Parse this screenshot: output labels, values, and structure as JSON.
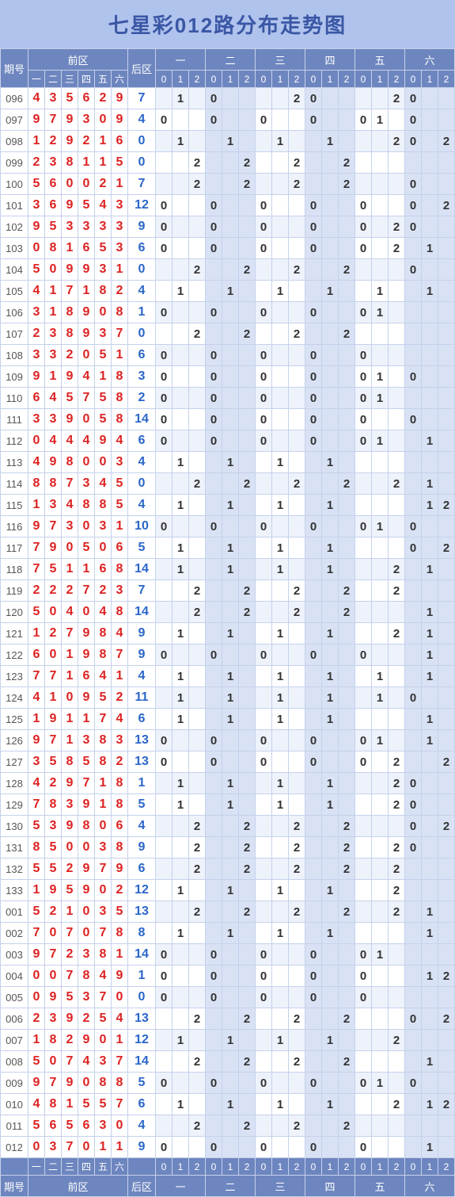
{
  "title": "七星彩012路分布走势图",
  "headers": {
    "issue": "期号",
    "front_group": "前区",
    "front_sub": [
      "一",
      "二",
      "三",
      "四",
      "五",
      "六"
    ],
    "back": "后区",
    "mod_groups": [
      "一",
      "二",
      "三",
      "四",
      "五",
      "六"
    ],
    "mod_sub": [
      "0",
      "1",
      "2"
    ]
  },
  "chart_data": {
    "type": "table",
    "title": "七星彩012路分布走势图",
    "columns": [
      "期号",
      "前区1",
      "前区2",
      "前区3",
      "前区4",
      "前区5",
      "前区6",
      "后区",
      "一0",
      "一1",
      "一2",
      "二0",
      "二1",
      "二2",
      "三0",
      "三1",
      "三2",
      "四0",
      "四1",
      "四2",
      "五0",
      "五1",
      "五2",
      "六0",
      "六1",
      "六2"
    ],
    "rows": [
      [
        "096",
        4,
        3,
        5,
        6,
        2,
        9,
        7,
        null,
        1,
        null,
        0,
        null,
        null,
        null,
        null,
        2,
        0,
        null,
        null,
        null,
        null,
        2,
        0,
        null,
        null
      ],
      [
        "097",
        9,
        7,
        9,
        3,
        0,
        9,
        4,
        0,
        null,
        null,
        0,
        null,
        null,
        0,
        null,
        null,
        0,
        null,
        null,
        0,
        1,
        null,
        0,
        null,
        null
      ],
      [
        "098",
        1,
        2,
        9,
        2,
        1,
        6,
        0,
        null,
        1,
        null,
        null,
        1,
        null,
        null,
        1,
        null,
        null,
        1,
        null,
        null,
        null,
        2,
        0,
        null,
        2
      ],
      [
        "099",
        2,
        3,
        8,
        1,
        1,
        5,
        0,
        null,
        null,
        2,
        null,
        null,
        2,
        null,
        null,
        2,
        null,
        null,
        2,
        null,
        null,
        null,
        null,
        null,
        null
      ],
      [
        "100",
        5,
        6,
        0,
        0,
        2,
        1,
        7,
        null,
        null,
        2,
        null,
        null,
        2,
        null,
        null,
        2,
        null,
        null,
        2,
        null,
        null,
        null,
        0,
        null,
        null
      ],
      [
        "101",
        3,
        6,
        9,
        5,
        4,
        3,
        12,
        0,
        null,
        null,
        0,
        null,
        null,
        0,
        null,
        null,
        0,
        null,
        null,
        0,
        null,
        null,
        0,
        null,
        2
      ],
      [
        "102",
        9,
        5,
        3,
        3,
        3,
        3,
        9,
        0,
        null,
        null,
        0,
        null,
        null,
        0,
        null,
        null,
        0,
        null,
        null,
        0,
        null,
        2,
        0,
        null,
        null
      ],
      [
        "103",
        0,
        8,
        1,
        6,
        5,
        3,
        6,
        0,
        null,
        null,
        0,
        null,
        null,
        0,
        null,
        null,
        0,
        null,
        null,
        0,
        null,
        2,
        null,
        1,
        null
      ],
      [
        "104",
        5,
        0,
        9,
        9,
        3,
        1,
        0,
        null,
        null,
        2,
        null,
        null,
        2,
        null,
        null,
        2,
        null,
        null,
        2,
        null,
        null,
        null,
        0,
        null,
        null
      ],
      [
        "105",
        4,
        1,
        7,
        1,
        8,
        2,
        4,
        null,
        1,
        null,
        null,
        1,
        null,
        null,
        1,
        null,
        null,
        1,
        null,
        null,
        1,
        null,
        null,
        1,
        null
      ],
      [
        "106",
        3,
        1,
        8,
        9,
        0,
        8,
        1,
        0,
        null,
        null,
        0,
        null,
        null,
        0,
        null,
        null,
        0,
        null,
        null,
        0,
        1,
        null,
        null,
        null,
        null
      ],
      [
        "107",
        2,
        3,
        8,
        9,
        3,
        7,
        0,
        null,
        null,
        2,
        null,
        null,
        2,
        null,
        null,
        2,
        null,
        null,
        2,
        null,
        null,
        null,
        null,
        null,
        null
      ],
      [
        "108",
        3,
        3,
        2,
        0,
        5,
        1,
        6,
        0,
        null,
        null,
        0,
        null,
        null,
        0,
        null,
        null,
        0,
        null,
        null,
        0,
        null,
        null,
        null,
        null,
        null
      ],
      [
        "109",
        9,
        1,
        9,
        4,
        1,
        8,
        3,
        0,
        null,
        null,
        0,
        null,
        null,
        0,
        null,
        null,
        0,
        null,
        null,
        0,
        1,
        null,
        0,
        null,
        null
      ],
      [
        "110",
        6,
        4,
        5,
        7,
        5,
        8,
        2,
        0,
        null,
        null,
        0,
        null,
        null,
        0,
        null,
        null,
        0,
        null,
        null,
        0,
        1,
        null,
        null,
        null,
        null
      ],
      [
        "111",
        3,
        3,
        9,
        0,
        5,
        8,
        14,
        0,
        null,
        null,
        0,
        null,
        null,
        0,
        null,
        null,
        0,
        null,
        null,
        0,
        null,
        null,
        0,
        null,
        null
      ],
      [
        "112",
        0,
        4,
        4,
        4,
        9,
        4,
        6,
        0,
        null,
        null,
        0,
        null,
        null,
        0,
        null,
        null,
        0,
        null,
        null,
        0,
        1,
        null,
        null,
        1,
        null
      ],
      [
        "113",
        4,
        9,
        8,
        0,
        0,
        3,
        4,
        null,
        1,
        null,
        null,
        1,
        null,
        null,
        1,
        null,
        null,
        1,
        null,
        null,
        null,
        null,
        null,
        null,
        null
      ],
      [
        "114",
        8,
        8,
        7,
        3,
        4,
        5,
        0,
        null,
        null,
        2,
        null,
        null,
        2,
        null,
        null,
        2,
        null,
        null,
        2,
        null,
        null,
        2,
        null,
        1,
        null
      ],
      [
        "115",
        1,
        3,
        4,
        8,
        8,
        5,
        4,
        null,
        1,
        null,
        null,
        1,
        null,
        null,
        1,
        null,
        null,
        1,
        null,
        null,
        null,
        null,
        null,
        1,
        2
      ],
      [
        "116",
        9,
        7,
        3,
        0,
        3,
        1,
        10,
        0,
        null,
        null,
        0,
        null,
        null,
        0,
        null,
        null,
        0,
        null,
        null,
        0,
        1,
        null,
        0,
        null,
        null
      ],
      [
        "117",
        7,
        9,
        0,
        5,
        0,
        6,
        5,
        null,
        1,
        null,
        null,
        1,
        null,
        null,
        1,
        null,
        null,
        1,
        null,
        null,
        null,
        null,
        0,
        null,
        2
      ],
      [
        "118",
        7,
        5,
        1,
        1,
        6,
        8,
        14,
        null,
        1,
        null,
        null,
        1,
        null,
        null,
        1,
        null,
        null,
        1,
        null,
        null,
        null,
        2,
        null,
        1,
        null
      ],
      [
        "119",
        2,
        2,
        2,
        7,
        2,
        3,
        7,
        null,
        null,
        2,
        null,
        null,
        2,
        null,
        null,
        2,
        null,
        null,
        2,
        null,
        null,
        2,
        null,
        null,
        null
      ],
      [
        "120",
        5,
        0,
        4,
        0,
        4,
        8,
        14,
        null,
        null,
        2,
        null,
        null,
        2,
        null,
        null,
        2,
        null,
        null,
        2,
        null,
        null,
        null,
        null,
        1,
        null
      ],
      [
        "121",
        1,
        2,
        7,
        9,
        8,
        4,
        9,
        null,
        1,
        null,
        null,
        1,
        null,
        null,
        1,
        null,
        null,
        1,
        null,
        null,
        null,
        2,
        null,
        1,
        null
      ],
      [
        "122",
        6,
        0,
        1,
        9,
        8,
        7,
        9,
        0,
        null,
        null,
        0,
        null,
        null,
        0,
        null,
        null,
        0,
        null,
        null,
        0,
        null,
        null,
        null,
        1,
        null
      ],
      [
        "123",
        7,
        7,
        1,
        6,
        4,
        1,
        4,
        null,
        1,
        null,
        null,
        1,
        null,
        null,
        1,
        null,
        null,
        1,
        null,
        null,
        1,
        null,
        null,
        1,
        null
      ],
      [
        "124",
        4,
        1,
        0,
        9,
        5,
        2,
        11,
        null,
        1,
        null,
        null,
        1,
        null,
        null,
        1,
        null,
        null,
        1,
        null,
        null,
        1,
        null,
        0,
        null,
        null
      ],
      [
        "125",
        1,
        9,
        1,
        1,
        7,
        4,
        6,
        null,
        1,
        null,
        null,
        1,
        null,
        null,
        1,
        null,
        null,
        1,
        null,
        null,
        null,
        null,
        null,
        1,
        null
      ],
      [
        "126",
        9,
        7,
        1,
        3,
        8,
        3,
        13,
        0,
        null,
        null,
        0,
        null,
        null,
        0,
        null,
        null,
        0,
        null,
        null,
        0,
        1,
        null,
        null,
        1,
        null
      ],
      [
        "127",
        3,
        5,
        8,
        5,
        8,
        2,
        13,
        0,
        null,
        null,
        0,
        null,
        null,
        0,
        null,
        null,
        0,
        null,
        null,
        0,
        null,
        2,
        null,
        null,
        2
      ],
      [
        "128",
        4,
        2,
        9,
        7,
        1,
        8,
        1,
        null,
        1,
        null,
        null,
        1,
        null,
        null,
        1,
        null,
        null,
        1,
        null,
        null,
        null,
        2,
        0,
        null,
        null
      ],
      [
        "129",
        7,
        8,
        3,
        9,
        1,
        8,
        5,
        null,
        1,
        null,
        null,
        1,
        null,
        null,
        1,
        null,
        null,
        1,
        null,
        null,
        null,
        2,
        0,
        null,
        null
      ],
      [
        "130",
        5,
        3,
        9,
        8,
        0,
        6,
        4,
        null,
        null,
        2,
        null,
        null,
        2,
        null,
        null,
        2,
        null,
        null,
        2,
        null,
        null,
        null,
        0,
        null,
        2
      ],
      [
        "131",
        8,
        5,
        0,
        0,
        3,
        8,
        9,
        null,
        null,
        2,
        null,
        null,
        2,
        null,
        null,
        2,
        null,
        null,
        2,
        null,
        null,
        2,
        0,
        null,
        null
      ],
      [
        "132",
        5,
        5,
        2,
        9,
        7,
        9,
        6,
        null,
        null,
        2,
        null,
        null,
        2,
        null,
        null,
        2,
        null,
        null,
        2,
        null,
        null,
        2,
        null,
        null,
        null
      ],
      [
        "133",
        1,
        9,
        5,
        9,
        0,
        2,
        12,
        null,
        1,
        null,
        null,
        1,
        null,
        null,
        1,
        null,
        null,
        1,
        null,
        null,
        null,
        2,
        null,
        null,
        null
      ],
      [
        "001",
        5,
        2,
        1,
        0,
        3,
        5,
        13,
        null,
        null,
        2,
        null,
        null,
        2,
        null,
        null,
        2,
        null,
        null,
        2,
        null,
        null,
        2,
        null,
        1,
        null
      ],
      [
        "002",
        7,
        0,
        7,
        0,
        7,
        8,
        8,
        null,
        1,
        null,
        null,
        1,
        null,
        null,
        1,
        null,
        null,
        1,
        null,
        null,
        null,
        null,
        null,
        1,
        null
      ],
      [
        "003",
        9,
        7,
        2,
        3,
        8,
        1,
        14,
        0,
        null,
        null,
        0,
        null,
        null,
        0,
        null,
        null,
        0,
        null,
        null,
        0,
        1,
        null,
        null,
        null,
        null
      ],
      [
        "004",
        0,
        0,
        7,
        8,
        4,
        9,
        1,
        0,
        null,
        null,
        0,
        null,
        null,
        0,
        null,
        null,
        0,
        null,
        null,
        0,
        null,
        null,
        null,
        1,
        2
      ],
      [
        "005",
        0,
        9,
        5,
        3,
        7,
        0,
        0,
        0,
        null,
        null,
        0,
        null,
        null,
        0,
        null,
        null,
        0,
        null,
        null,
        0,
        null,
        null,
        null,
        null,
        null
      ],
      [
        "006",
        2,
        3,
        9,
        2,
        5,
        4,
        13,
        null,
        null,
        2,
        null,
        null,
        2,
        null,
        null,
        2,
        null,
        null,
        2,
        null,
        null,
        null,
        0,
        null,
        2
      ],
      [
        "007",
        1,
        8,
        2,
        9,
        0,
        1,
        12,
        null,
        1,
        null,
        null,
        1,
        null,
        null,
        1,
        null,
        null,
        1,
        null,
        null,
        null,
        2,
        null,
        null,
        null
      ],
      [
        "008",
        5,
        0,
        7,
        4,
        3,
        7,
        14,
        null,
        null,
        2,
        null,
        null,
        2,
        null,
        null,
        2,
        null,
        null,
        2,
        null,
        null,
        null,
        null,
        1,
        null
      ],
      [
        "009",
        9,
        7,
        9,
        0,
        8,
        8,
        5,
        0,
        null,
        null,
        0,
        null,
        null,
        0,
        null,
        null,
        0,
        null,
        null,
        0,
        1,
        null,
        0,
        null,
        null
      ],
      [
        "010",
        4,
        8,
        1,
        5,
        5,
        7,
        6,
        null,
        1,
        null,
        null,
        1,
        null,
        null,
        1,
        null,
        null,
        1,
        null,
        null,
        null,
        2,
        null,
        1,
        2
      ],
      [
        "011",
        5,
        6,
        5,
        6,
        3,
        0,
        4,
        null,
        null,
        2,
        null,
        null,
        2,
        null,
        null,
        2,
        null,
        null,
        2,
        null,
        null,
        null,
        null,
        null,
        null
      ],
      [
        "012",
        0,
        3,
        7,
        0,
        1,
        1,
        9,
        0,
        null,
        null,
        0,
        null,
        null,
        0,
        null,
        null,
        0,
        null,
        null,
        0,
        null,
        null,
        null,
        1,
        null
      ]
    ]
  }
}
